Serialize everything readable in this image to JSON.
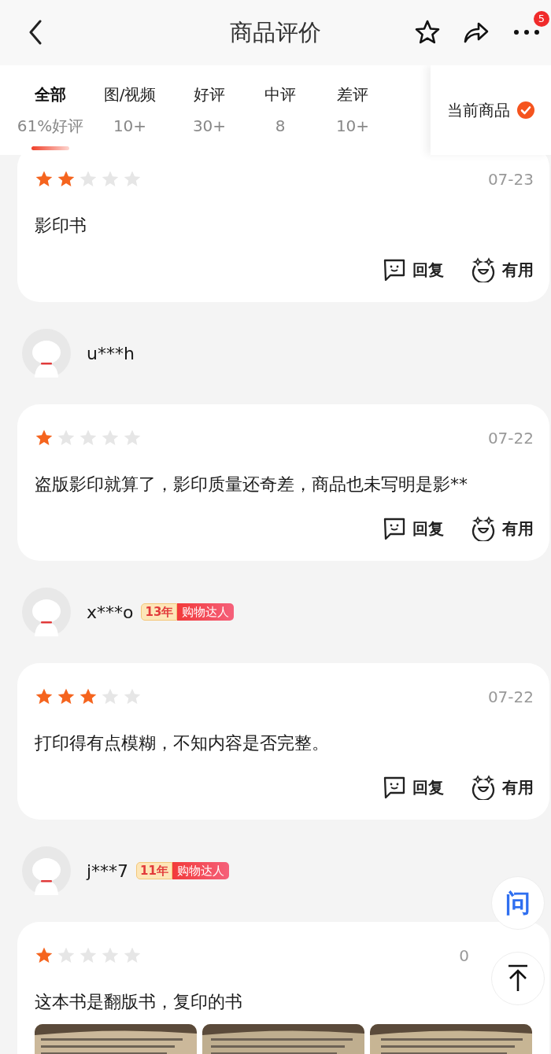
{
  "header": {
    "title": "商品评价",
    "more_badge": "5"
  },
  "tabs": [
    {
      "label": "全部",
      "count": "61%好评",
      "selected": true
    },
    {
      "label": "图/视频",
      "count": "10+",
      "selected": false
    },
    {
      "label": "好评",
      "count": "30+",
      "selected": false
    },
    {
      "label": "中评",
      "count": "8",
      "selected": false
    },
    {
      "label": "差评",
      "count": "10+",
      "selected": false
    }
  ],
  "current_product": {
    "label": "当前商品",
    "checked": true
  },
  "reviews": [
    {
      "stars": 2,
      "date": "07-23",
      "text": "影印书",
      "actions": [
        {
          "kind": "reply",
          "label": "回复"
        },
        {
          "kind": "useful",
          "label": "有用"
        }
      ]
    },
    {
      "user": "u***h",
      "stars": 1,
      "date": "07-22",
      "text": "盗版影印就算了，影印质量还奇差，商品也未写明是影**",
      "actions": [
        {
          "kind": "reply",
          "label": "回复"
        },
        {
          "kind": "useful",
          "label": "有用"
        }
      ]
    },
    {
      "user": "x***o",
      "badge": {
        "years": "13年",
        "title": "购物达人"
      },
      "stars": 3,
      "date": "07-22",
      "text": "打印得有点模糊，不知内容是否完整。",
      "actions": [
        {
          "kind": "reply",
          "label": "回复"
        },
        {
          "kind": "useful",
          "label": "有用"
        }
      ]
    },
    {
      "user": "j***7",
      "badge": {
        "years": "11年",
        "title": "购物达人"
      },
      "stars": 1,
      "date": "0",
      "text": "这本书是翻版书，复印的书",
      "photos": [
        {
          "kind": "picture"
        },
        {
          "kind": "picture"
        },
        {
          "kind": "picture"
        }
      ]
    }
  ],
  "floating": {
    "ask": "问"
  }
}
